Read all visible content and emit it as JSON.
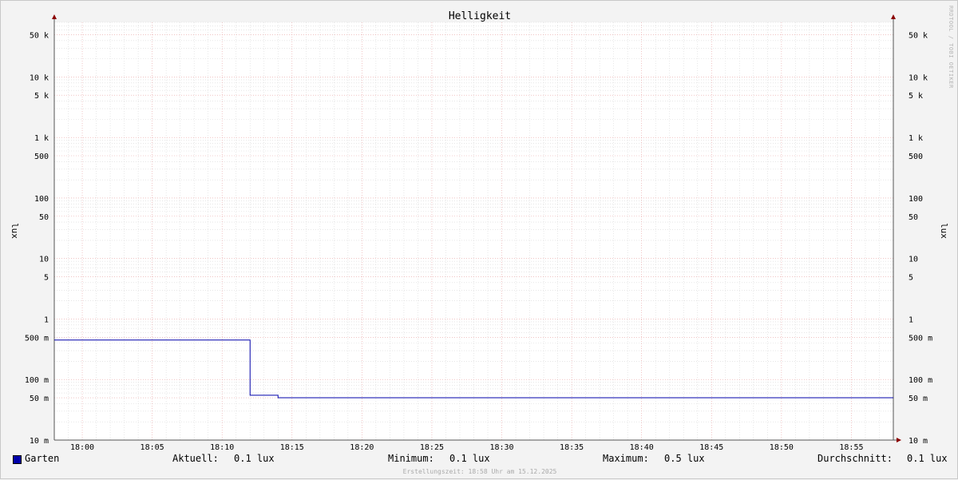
{
  "chart_data": {
    "type": "line",
    "title": "Helligkeit",
    "ylabel": "lux",
    "ylabel_right": "lux",
    "yscale": "log",
    "ylim": [
      10,
      80000
    ],
    "x_range": [
      "17:58",
      "18:58"
    ],
    "x_ticks": [
      "18:00",
      "18:05",
      "18:10",
      "18:15",
      "18:20",
      "18:25",
      "18:30",
      "18:35",
      "18:40",
      "18:45",
      "18:50",
      "18:55"
    ],
    "y_ticks": [
      {
        "label": "10 m",
        "value": 0.01
      },
      {
        "label": "50 m",
        "value": 0.05
      },
      {
        "label": "100 m",
        "value": 0.1
      },
      {
        "label": "500 m",
        "value": 0.5
      },
      {
        "label": "1",
        "value": 1
      },
      {
        "label": "5",
        "value": 5
      },
      {
        "label": "10",
        "value": 10
      },
      {
        "label": "50",
        "value": 50
      },
      {
        "label": "100",
        "value": 100
      },
      {
        "label": "500",
        "value": 500
      },
      {
        "label": "1 k",
        "value": 1000
      },
      {
        "label": "5 k",
        "value": 5000
      },
      {
        "label": "10 k",
        "value": 10000
      },
      {
        "label": "50 k",
        "value": 50000
      }
    ],
    "series": [
      {
        "name": "Garten",
        "color": "#0000aa",
        "x": [
          "17:58",
          "18:12",
          "18:14",
          "18:58"
        ],
        "y": [
          0.45,
          0.055,
          0.05,
          0.05
        ]
      }
    ],
    "grid": true,
    "watermark": "RRDTOOL / TOBI OETIKER"
  },
  "legend": {
    "series_name": "Garten",
    "current_label": "Aktuell:",
    "current_value": "0.1 lux",
    "min_label": "Minimum:",
    "min_value": "0.1 lux",
    "max_label": "Maximum:",
    "max_value": "0.5 lux",
    "avg_label": "Durchschnitt:",
    "avg_value": "0.1 lux"
  },
  "footer": "Erstellungszeit: 18:58 Uhr am 15.12.2025"
}
